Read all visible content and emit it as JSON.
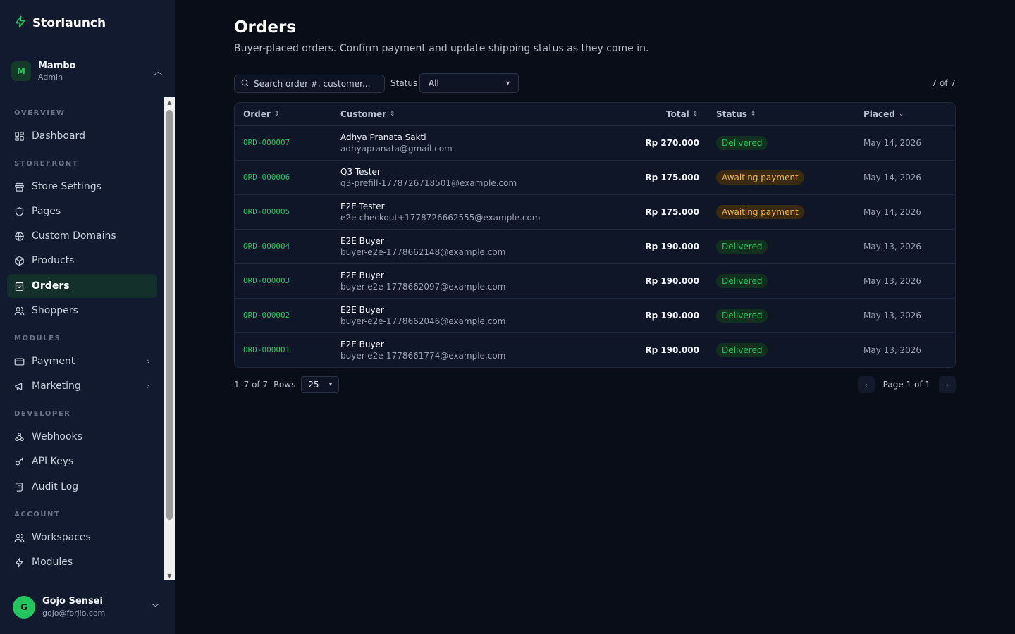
{
  "brand": {
    "name": "Storlaunch",
    "icon": "bolt-icon",
    "accent": "#22c55e"
  },
  "workspace": {
    "initial": "M",
    "name": "Mambo",
    "role": "Admin"
  },
  "sidebar": {
    "sections": {
      "overview": "OVERVIEW",
      "storefront": "STOREFRONT",
      "modules": "MODULES",
      "developer": "DEVELOPER",
      "account": "ACCOUNT"
    },
    "items": {
      "dashboard": "Dashboard",
      "store_settings": "Store Settings",
      "pages": "Pages",
      "custom_domains": "Custom Domains",
      "products": "Products",
      "orders": "Orders",
      "shoppers": "Shoppers",
      "payment": "Payment",
      "marketing": "Marketing",
      "webhooks": "Webhooks",
      "api_keys": "API Keys",
      "audit_log": "Audit Log",
      "workspaces": "Workspaces",
      "modules": "Modules"
    },
    "active": "orders"
  },
  "user": {
    "initial": "G",
    "name": "Gojo Sensei",
    "email": "gojo@forjio.com"
  },
  "page": {
    "title": "Orders",
    "subtitle": "Buyer-placed orders. Confirm payment and update shipping status as they come in."
  },
  "filters": {
    "search_placeholder": "Search order #, customer...",
    "status_label": "Status",
    "status_value": "All",
    "count": "7 of 7"
  },
  "table": {
    "headers": {
      "order": "Order",
      "customer": "Customer",
      "total": "Total",
      "status": "Status",
      "placed": "Placed"
    },
    "rows": [
      {
        "order": "ORD-000007",
        "name": "Adhya Pranata Sakti",
        "email": "adhyapranata@gmail.com",
        "total": "Rp 270.000",
        "status": "Delivered",
        "placed": "May 14, 2026"
      },
      {
        "order": "ORD-000006",
        "name": "Q3 Tester",
        "email": "q3-prefill-1778726718501@example.com",
        "total": "Rp 175.000",
        "status": "Awaiting payment",
        "placed": "May 14, 2026"
      },
      {
        "order": "ORD-000005",
        "name": "E2E Tester",
        "email": "e2e-checkout+1778726662555@example.com",
        "total": "Rp 175.000",
        "status": "Awaiting payment",
        "placed": "May 14, 2026"
      },
      {
        "order": "ORD-000004",
        "name": "E2E Buyer",
        "email": "buyer-e2e-1778662148@example.com",
        "total": "Rp 190.000",
        "status": "Delivered",
        "placed": "May 13, 2026"
      },
      {
        "order": "ORD-000003",
        "name": "E2E Buyer",
        "email": "buyer-e2e-1778662097@example.com",
        "total": "Rp 190.000",
        "status": "Delivered",
        "placed": "May 13, 2026"
      },
      {
        "order": "ORD-000002",
        "name": "E2E Buyer",
        "email": "buyer-e2e-1778662046@example.com",
        "total": "Rp 190.000",
        "status": "Delivered",
        "placed": "May 13, 2026"
      },
      {
        "order": "ORD-000001",
        "name": "E2E Buyer",
        "email": "buyer-e2e-1778661774@example.com",
        "total": "Rp 190.000",
        "status": "Delivered",
        "placed": "May 13, 2026"
      }
    ]
  },
  "footer": {
    "range": "1–7 of 7",
    "rows_label": "Rows",
    "rows_value": "25",
    "page_text": "Page 1 of 1"
  },
  "colors": {
    "delivered": "#22c55e",
    "awaiting": "#f5b53a"
  }
}
